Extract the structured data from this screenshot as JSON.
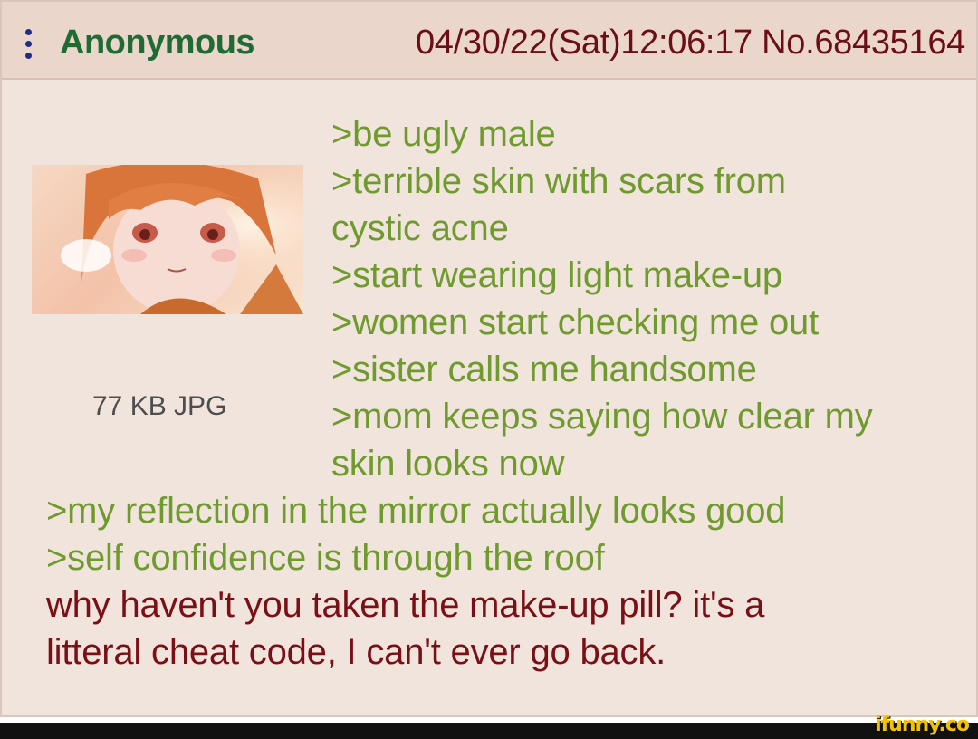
{
  "header": {
    "poster_name": "Anonymous",
    "post_meta": "04/30/22(Sat)12:06:17 No.68435164"
  },
  "attachment": {
    "file_info": "77 KB JPG"
  },
  "body": {
    "lines": [
      {
        "text": ">be ugly male",
        "kind": "quote"
      },
      {
        "text": ">terrible skin with scars from",
        "kind": "quote"
      },
      {
        "text": "cystic acne",
        "kind": "quote"
      },
      {
        "text": ">start wearing light make-up",
        "kind": "quote"
      },
      {
        "text": ">women start checking me out",
        "kind": "quote"
      },
      {
        "text": ">sister calls me handsome",
        "kind": "quote"
      },
      {
        "text": ">mom keeps saying how clear my",
        "kind": "quote"
      },
      {
        "text": "skin looks now",
        "kind": "quote"
      },
      {
        "text": ">my reflection in the mirror actually looks good",
        "kind": "quote"
      },
      {
        "text": ">self confidence is through the roof",
        "kind": "quote"
      },
      {
        "text": "why haven't you taken the make-up pill? it's a",
        "kind": "plain"
      },
      {
        "text": "litteral cheat code, I can't ever go back.",
        "kind": "plain"
      }
    ]
  },
  "watermark": "ifunny.co",
  "colors": {
    "post_bg": "#f1e4dc",
    "header_bg": "#ead6cb",
    "name": "#1f6b34",
    "meta": "#6b0f16",
    "greentext": "#6f9a2e",
    "plaintext": "#7a0f16"
  }
}
